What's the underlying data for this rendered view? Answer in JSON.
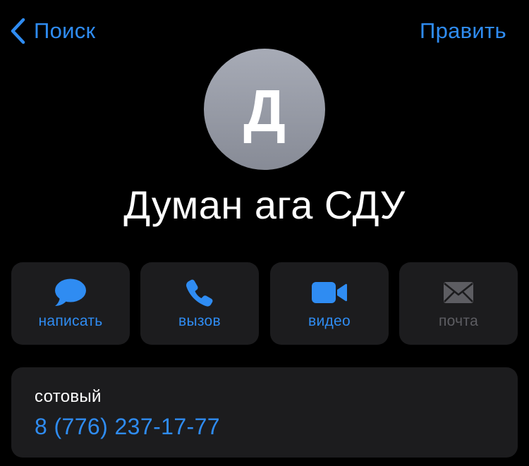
{
  "nav": {
    "back_label": "Поиск",
    "edit_label": "Править"
  },
  "contact": {
    "initial": "Д",
    "name": "Думан ага СДУ"
  },
  "actions": [
    {
      "label": "написать",
      "icon": "message-bubble-icon",
      "enabled": true
    },
    {
      "label": "вызов",
      "icon": "phone-icon",
      "enabled": true
    },
    {
      "label": "видео",
      "icon": "video-camera-icon",
      "enabled": true
    },
    {
      "label": "почта",
      "icon": "envelope-icon",
      "enabled": false
    }
  ],
  "phone": {
    "label": "сотовый",
    "number": "8 (776) 237-17-77"
  },
  "colors": {
    "accent": "#2f8cf2",
    "background": "#000000",
    "card": "#1c1c1e",
    "disabled": "#5d5d62",
    "avatar": "#9a9ea9"
  }
}
